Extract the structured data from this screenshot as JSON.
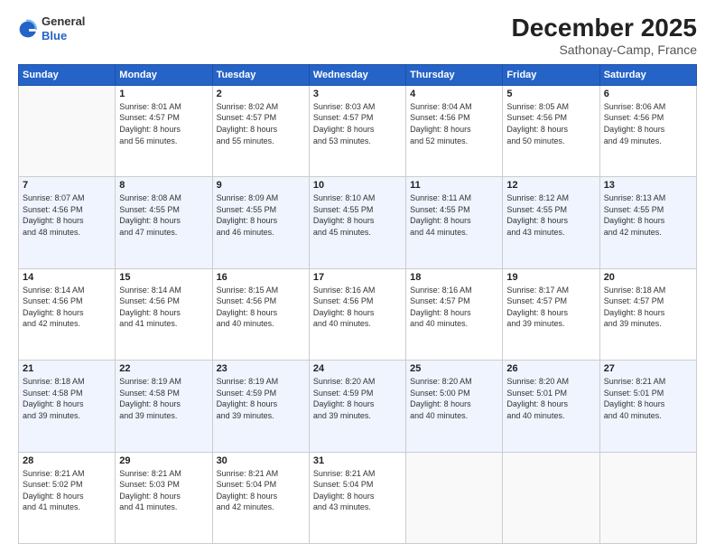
{
  "header": {
    "logo": {
      "general": "General",
      "blue": "Blue"
    },
    "title": "December 2025",
    "location": "Sathonay-Camp, France"
  },
  "weekdays": [
    "Sunday",
    "Monday",
    "Tuesday",
    "Wednesday",
    "Thursday",
    "Friday",
    "Saturday"
  ],
  "weeks": [
    [
      {
        "day": "",
        "info": ""
      },
      {
        "day": "1",
        "info": "Sunrise: 8:01 AM\nSunset: 4:57 PM\nDaylight: 8 hours\nand 56 minutes."
      },
      {
        "day": "2",
        "info": "Sunrise: 8:02 AM\nSunset: 4:57 PM\nDaylight: 8 hours\nand 55 minutes."
      },
      {
        "day": "3",
        "info": "Sunrise: 8:03 AM\nSunset: 4:57 PM\nDaylight: 8 hours\nand 53 minutes."
      },
      {
        "day": "4",
        "info": "Sunrise: 8:04 AM\nSunset: 4:56 PM\nDaylight: 8 hours\nand 52 minutes."
      },
      {
        "day": "5",
        "info": "Sunrise: 8:05 AM\nSunset: 4:56 PM\nDaylight: 8 hours\nand 50 minutes."
      },
      {
        "day": "6",
        "info": "Sunrise: 8:06 AM\nSunset: 4:56 PM\nDaylight: 8 hours\nand 49 minutes."
      }
    ],
    [
      {
        "day": "7",
        "info": "Sunrise: 8:07 AM\nSunset: 4:56 PM\nDaylight: 8 hours\nand 48 minutes."
      },
      {
        "day": "8",
        "info": "Sunrise: 8:08 AM\nSunset: 4:55 PM\nDaylight: 8 hours\nand 47 minutes."
      },
      {
        "day": "9",
        "info": "Sunrise: 8:09 AM\nSunset: 4:55 PM\nDaylight: 8 hours\nand 46 minutes."
      },
      {
        "day": "10",
        "info": "Sunrise: 8:10 AM\nSunset: 4:55 PM\nDaylight: 8 hours\nand 45 minutes."
      },
      {
        "day": "11",
        "info": "Sunrise: 8:11 AM\nSunset: 4:55 PM\nDaylight: 8 hours\nand 44 minutes."
      },
      {
        "day": "12",
        "info": "Sunrise: 8:12 AM\nSunset: 4:55 PM\nDaylight: 8 hours\nand 43 minutes."
      },
      {
        "day": "13",
        "info": "Sunrise: 8:13 AM\nSunset: 4:55 PM\nDaylight: 8 hours\nand 42 minutes."
      }
    ],
    [
      {
        "day": "14",
        "info": "Sunrise: 8:14 AM\nSunset: 4:56 PM\nDaylight: 8 hours\nand 42 minutes."
      },
      {
        "day": "15",
        "info": "Sunrise: 8:14 AM\nSunset: 4:56 PM\nDaylight: 8 hours\nand 41 minutes."
      },
      {
        "day": "16",
        "info": "Sunrise: 8:15 AM\nSunset: 4:56 PM\nDaylight: 8 hours\nand 40 minutes."
      },
      {
        "day": "17",
        "info": "Sunrise: 8:16 AM\nSunset: 4:56 PM\nDaylight: 8 hours\nand 40 minutes."
      },
      {
        "day": "18",
        "info": "Sunrise: 8:16 AM\nSunset: 4:57 PM\nDaylight: 8 hours\nand 40 minutes."
      },
      {
        "day": "19",
        "info": "Sunrise: 8:17 AM\nSunset: 4:57 PM\nDaylight: 8 hours\nand 39 minutes."
      },
      {
        "day": "20",
        "info": "Sunrise: 8:18 AM\nSunset: 4:57 PM\nDaylight: 8 hours\nand 39 minutes."
      }
    ],
    [
      {
        "day": "21",
        "info": "Sunrise: 8:18 AM\nSunset: 4:58 PM\nDaylight: 8 hours\nand 39 minutes."
      },
      {
        "day": "22",
        "info": "Sunrise: 8:19 AM\nSunset: 4:58 PM\nDaylight: 8 hours\nand 39 minutes."
      },
      {
        "day": "23",
        "info": "Sunrise: 8:19 AM\nSunset: 4:59 PM\nDaylight: 8 hours\nand 39 minutes."
      },
      {
        "day": "24",
        "info": "Sunrise: 8:20 AM\nSunset: 4:59 PM\nDaylight: 8 hours\nand 39 minutes."
      },
      {
        "day": "25",
        "info": "Sunrise: 8:20 AM\nSunset: 5:00 PM\nDaylight: 8 hours\nand 40 minutes."
      },
      {
        "day": "26",
        "info": "Sunrise: 8:20 AM\nSunset: 5:01 PM\nDaylight: 8 hours\nand 40 minutes."
      },
      {
        "day": "27",
        "info": "Sunrise: 8:21 AM\nSunset: 5:01 PM\nDaylight: 8 hours\nand 40 minutes."
      }
    ],
    [
      {
        "day": "28",
        "info": "Sunrise: 8:21 AM\nSunset: 5:02 PM\nDaylight: 8 hours\nand 41 minutes."
      },
      {
        "day": "29",
        "info": "Sunrise: 8:21 AM\nSunset: 5:03 PM\nDaylight: 8 hours\nand 41 minutes."
      },
      {
        "day": "30",
        "info": "Sunrise: 8:21 AM\nSunset: 5:04 PM\nDaylight: 8 hours\nand 42 minutes."
      },
      {
        "day": "31",
        "info": "Sunrise: 8:21 AM\nSunset: 5:04 PM\nDaylight: 8 hours\nand 43 minutes."
      },
      {
        "day": "",
        "info": ""
      },
      {
        "day": "",
        "info": ""
      },
      {
        "day": "",
        "info": ""
      }
    ]
  ]
}
